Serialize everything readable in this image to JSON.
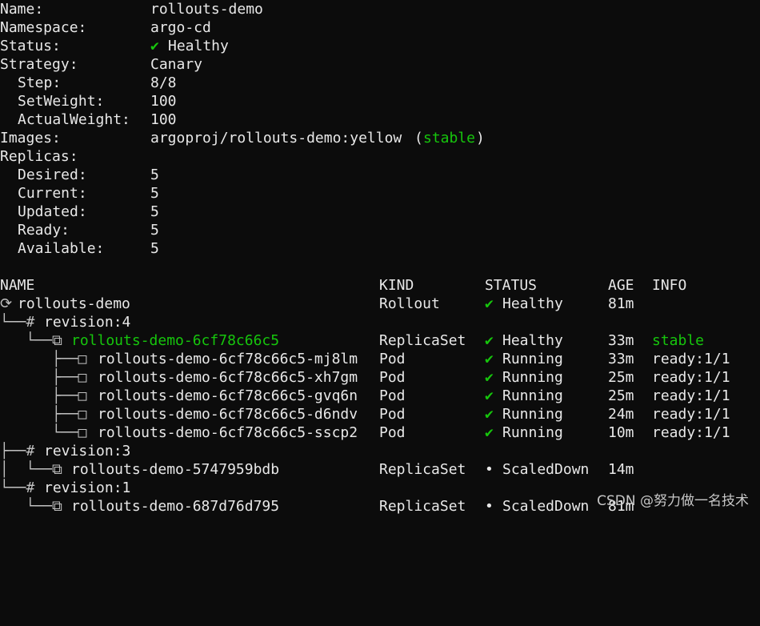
{
  "summary": {
    "name_label": "Name:",
    "name_value": "rollouts-demo",
    "namespace_label": "Namespace:",
    "namespace_value": "argo-cd",
    "status_label": "Status:",
    "status_icon": "✔",
    "status_value": "Healthy",
    "strategy_label": "Strategy:",
    "strategy_value": "Canary",
    "step_label": "Step:",
    "step_value": "8/8",
    "setweight_label": "SetWeight:",
    "setweight_value": "100",
    "actualweight_label": "ActualWeight:",
    "actualweight_value": "100",
    "images_label": "Images:",
    "images_value": "argoproj/rollouts-demo:yellow",
    "images_open": "(",
    "images_tag": "stable",
    "images_close": ")",
    "replicas_label": "Replicas:",
    "desired_label": "Desired:",
    "desired_value": "5",
    "current_label": "Current:",
    "current_value": "5",
    "updated_label": "Updated:",
    "updated_value": "5",
    "ready_label": "Ready:",
    "ready_value": "5",
    "available_label": "Available:",
    "available_value": "5"
  },
  "table": {
    "headers": {
      "name": "NAME",
      "kind": "KIND",
      "status": "STATUS",
      "age": "AGE",
      "info": "INFO"
    },
    "rows": [
      {
        "prefix": "⟳ ",
        "name": "rollouts-demo",
        "kind": "Rollout",
        "status_icon": "✔",
        "status": "Healthy",
        "age": "81m",
        "info": ""
      },
      {
        "prefix": "└──# ",
        "name": "revision:4",
        "kind": "",
        "status_icon": "",
        "status": "",
        "age": "",
        "info": ""
      },
      {
        "prefix": "   └──⧉ ",
        "name": "rollouts-demo-6cf78c66c5",
        "kind": "ReplicaSet",
        "status_icon": "✔",
        "status": "Healthy",
        "age": "33m",
        "info": "stable"
      },
      {
        "prefix": "      ├──□ ",
        "name": "rollouts-demo-6cf78c66c5-mj8lm",
        "kind": "Pod",
        "status_icon": "✔",
        "status": "Running",
        "age": "33m",
        "info": "ready:1/1"
      },
      {
        "prefix": "      ├──□ ",
        "name": "rollouts-demo-6cf78c66c5-xh7gm",
        "kind": "Pod",
        "status_icon": "✔",
        "status": "Running",
        "age": "25m",
        "info": "ready:1/1"
      },
      {
        "prefix": "      ├──□ ",
        "name": "rollouts-demo-6cf78c66c5-gvq6n",
        "kind": "Pod",
        "status_icon": "✔",
        "status": "Running",
        "age": "25m",
        "info": "ready:1/1"
      },
      {
        "prefix": "      ├──□ ",
        "name": "rollouts-demo-6cf78c66c5-d6ndv",
        "kind": "Pod",
        "status_icon": "✔",
        "status": "Running",
        "age": "24m",
        "info": "ready:1/1"
      },
      {
        "prefix": "      └──□ ",
        "name": "rollouts-demo-6cf78c66c5-sscp2",
        "kind": "Pod",
        "status_icon": "✔",
        "status": "Running",
        "age": "10m",
        "info": "ready:1/1"
      },
      {
        "prefix": "├──# ",
        "name": "revision:3",
        "kind": "",
        "status_icon": "",
        "status": "",
        "age": "",
        "info": ""
      },
      {
        "prefix": "│  └──⧉ ",
        "name": "rollouts-demo-5747959bdb",
        "kind": "ReplicaSet",
        "status_icon": "•",
        "status": "ScaledDown",
        "age": "14m",
        "info": ""
      },
      {
        "prefix": "└──# ",
        "name": "revision:1",
        "kind": "",
        "status_icon": "",
        "status": "",
        "age": "",
        "info": ""
      },
      {
        "prefix": "   └──⧉ ",
        "name": "rollouts-demo-687d76d795",
        "kind": "ReplicaSet",
        "status_icon": "•",
        "status": "ScaledDown",
        "age": "81m",
        "info": ""
      }
    ]
  },
  "watermark": "CSDN @努力做一名技术",
  "colors": {
    "background": "#0c0c0c",
    "text": "#e8e8e8",
    "green": "#16c60c"
  }
}
